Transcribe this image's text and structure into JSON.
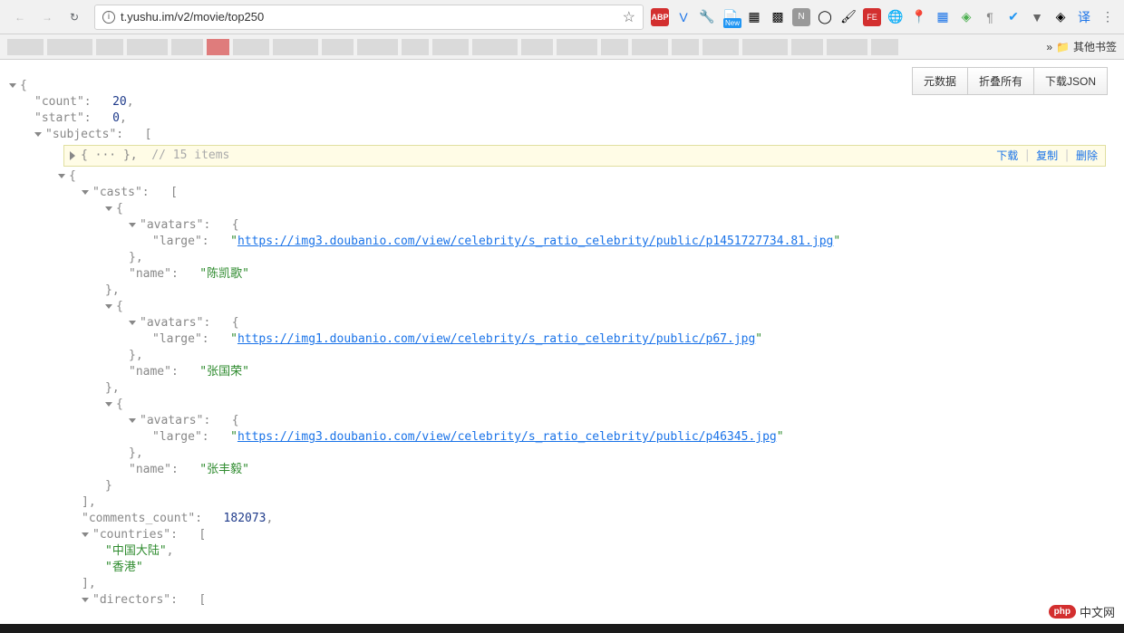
{
  "url": "t.yushu.im/v2/movie/top250",
  "bookmark_overflow": "»",
  "bookmark_other": "其他书签",
  "action_buttons": {
    "metadata": "元数据",
    "collapse_all": "折叠所有",
    "download_json": "下载JSON"
  },
  "highlight": {
    "summary": "{ ··· },",
    "comment": "// 15 items",
    "download": "下载",
    "copy": "复制",
    "delete": "删除"
  },
  "json": {
    "count_key": "\"count\"",
    "count_val": "20",
    "start_key": "\"start\"",
    "start_val": "0",
    "subjects_key": "\"subjects\"",
    "casts_key": "\"casts\"",
    "avatars_key": "\"avatars\"",
    "large_key": "\"large\"",
    "name_key": "\"name\"",
    "comments_count_key": "\"comments_count\"",
    "comments_count_val": "182073",
    "countries_key": "\"countries\"",
    "directors_key": "\"directors\"",
    "casts": [
      {
        "large_url": "https://img3.doubanio.com/view/celebrity/s_ratio_celebrity/public/p1451727734.81.jpg",
        "name": "\"陈凯歌\""
      },
      {
        "large_url": "https://img1.doubanio.com/view/celebrity/s_ratio_celebrity/public/p67.jpg",
        "name": "\"张国荣\""
      },
      {
        "large_url": "https://img3.doubanio.com/view/celebrity/s_ratio_celebrity/public/p46345.jpg",
        "name": "\"张丰毅\""
      }
    ],
    "countries": {
      "c1": "\"中国大陆\"",
      "c2": "\"香港\""
    }
  },
  "watermark": {
    "badge": "php",
    "text": "中文网"
  }
}
